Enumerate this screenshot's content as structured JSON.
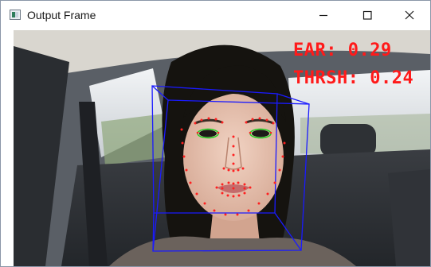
{
  "window": {
    "title": "Output Frame"
  },
  "titlebar": {
    "icons": {
      "app": "app-window-icon",
      "minimize": "minimize-icon",
      "maximize": "maximize-icon",
      "close": "close-icon"
    }
  },
  "overlay": {
    "ear_text": "EAR: 0.29",
    "thresh_text": "THRSH: 0.24",
    "text_color": "#ff1a1a",
    "landmark_color": "#ff2020",
    "eye_contour_color": "#21d021",
    "head_pose_box_color": "#1a1aff"
  }
}
